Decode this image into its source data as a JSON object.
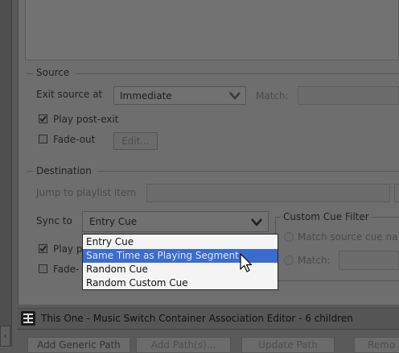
{
  "source": {
    "group_label": "Source",
    "exit_label": "Exit source at",
    "exit_value": "Immediate",
    "match_label": "Match:",
    "play_post_exit_label": "Play post-exit",
    "play_post_exit_checked": true,
    "fade_out_label": "Fade-out",
    "fade_out_checked": false,
    "edit_button": "Edit..."
  },
  "destination": {
    "group_label": "Destination",
    "jump_label": "Jump to playlist item",
    "sync_label": "Sync to",
    "sync_value": "Entry Cue",
    "play_label": "Play p",
    "play_checked": true,
    "fade_label": "Fade-",
    "fade_checked": false
  },
  "custom_cue_filter": {
    "group_label": "Custom Cue Filter",
    "match_source_label": "Match source cue na",
    "match_label": "Match:"
  },
  "dropdown": {
    "options": [
      "Entry Cue",
      "Same Time as Playing Segment",
      "Random Cue",
      "Random Custom Cue"
    ],
    "selected_index": 1
  },
  "footer": {
    "title": "This One - Music Switch Container Association Editor - 6 children",
    "buttons": [
      "Add Generic Path",
      "Add Path(s)...",
      "Update Path",
      "Remo"
    ]
  }
}
